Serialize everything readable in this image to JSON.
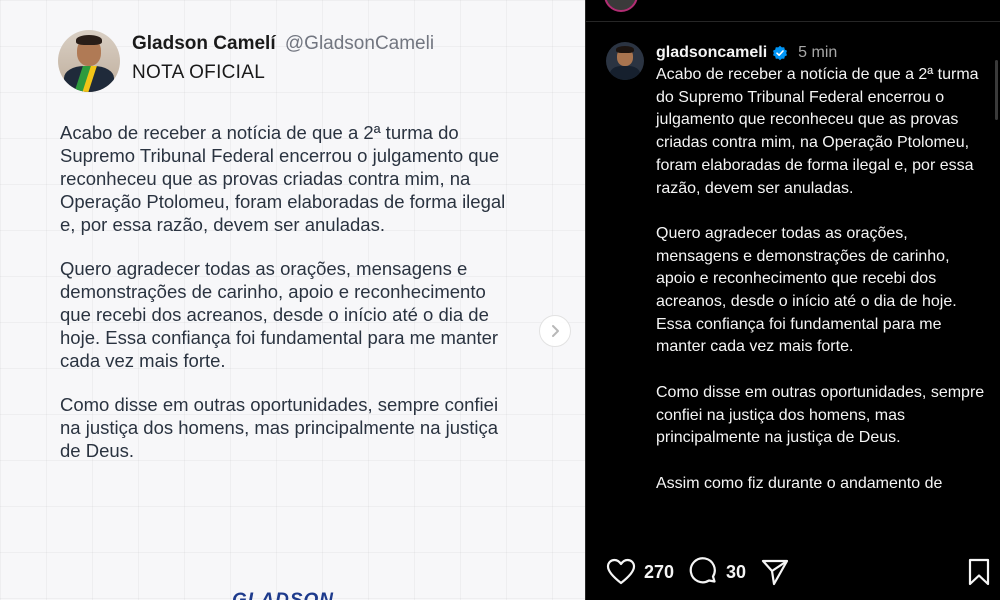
{
  "post_image": {
    "tweet_name": "Gladson Camelí",
    "tweet_handle": "@GladsonCameli",
    "tweet_label": "NOTA OFICIAL",
    "paragraphs": [
      "Acabo de receber a notícia de que a 2ª turma do Supremo Tribunal Federal encerrou o julgamento que reconheceu que as provas criadas contra mim, na Operação Ptolomeu, foram elaboradas de forma ilegal e, por essa razão, devem ser anuladas.",
      "Quero agradecer todas as orações, mensagens e demonstrações de carinho, apoio e reconhecimento que recebi dos acreanos, desde o início até o dia de hoje. Essa confiança foi fundamental para me manter cada vez mais forte.",
      "Como disse em outras oportunidades, sempre confiei na justiça dos homens, mas principalmente na justiça de Deus."
    ],
    "brand": "GLADSON",
    "next_icon": "chevron-right-icon"
  },
  "panel": {
    "username": "gladsoncameli",
    "time": "5 min",
    "caption_paragraphs": [
      "Acabo de receber a notícia de que a 2ª turma do Supremo Tribunal Federal encerrou o julgamento que reconheceu que as provas criadas contra mim, na Operação Ptolomeu, foram elaboradas de forma ilegal e, por essa razão, devem ser anuladas.",
      "Quero agradecer todas as orações, mensagens e demonstrações de carinho, apoio e reconhecimento que recebi dos acreanos, desde o início até o dia de hoje. Essa confiança foi fundamental para me manter cada vez mais forte.",
      "Como disse em outras oportunidades, sempre confiei na justiça dos homens, mas principalmente na justiça de Deus.",
      "Assim como fiz durante o andamento de"
    ],
    "verified_color": "#0095f6",
    "actions": {
      "likes": "270",
      "comments": "30",
      "like_icon": "heart-icon",
      "comment_icon": "comment-icon",
      "share_icon": "send-icon",
      "save_icon": "bookmark-icon"
    }
  }
}
